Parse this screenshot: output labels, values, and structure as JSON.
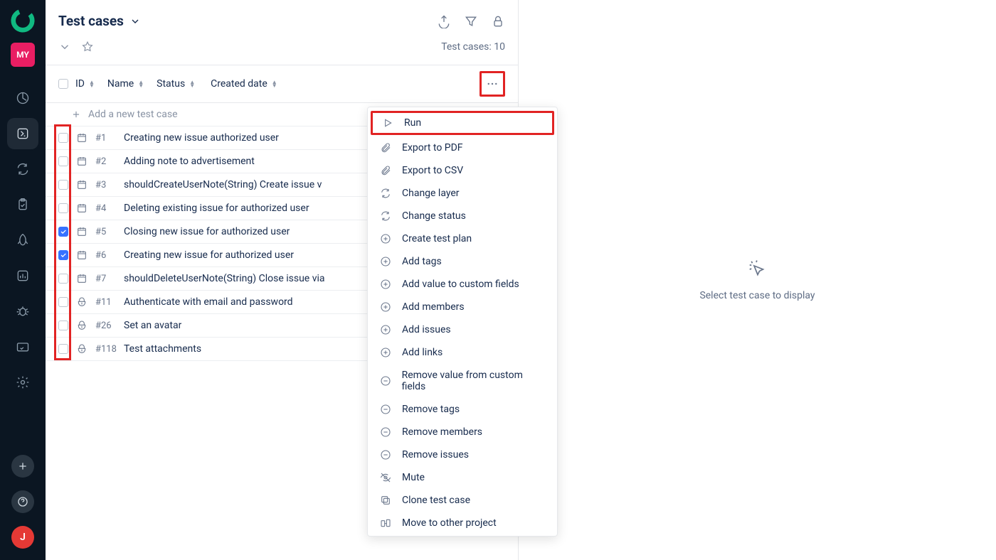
{
  "sidebar": {
    "project_badge": "MY",
    "avatar_letter": "J"
  },
  "header": {
    "title": "Test cases"
  },
  "subheader": {
    "count_label": "Test cases: 10"
  },
  "columns": {
    "id": "ID",
    "name": "Name",
    "status": "Status",
    "created": "Created date"
  },
  "add_row": {
    "label": "Add a new test case"
  },
  "rows": [
    {
      "id": "#1",
      "name": "Creating new issue authorized user",
      "checked": false,
      "type": "calendar"
    },
    {
      "id": "#2",
      "name": "Adding note to advertisement",
      "checked": false,
      "type": "calendar"
    },
    {
      "id": "#3",
      "name": "shouldCreateUserNote(String) Create issue v",
      "checked": false,
      "type": "calendar"
    },
    {
      "id": "#4",
      "name": "Deleting existing issue for authorized user",
      "checked": false,
      "type": "calendar"
    },
    {
      "id": "#5",
      "name": "Closing new issue for authorized user",
      "checked": true,
      "type": "calendar"
    },
    {
      "id": "#6",
      "name": "Creating new issue for authorized user",
      "checked": true,
      "type": "calendar"
    },
    {
      "id": "#7",
      "name": "shouldDeleteUserNote(String) Close issue via",
      "checked": false,
      "type": "calendar"
    },
    {
      "id": "#11",
      "name": "Authenticate with email and password",
      "checked": false,
      "type": "manual"
    },
    {
      "id": "#26",
      "name": "Set an avatar",
      "checked": false,
      "type": "manual"
    },
    {
      "id": "#118",
      "name": "Test attachments",
      "checked": false,
      "type": "manual"
    }
  ],
  "dropdown": {
    "items": [
      {
        "label": "Run",
        "icon": "play"
      },
      {
        "label": "Export to PDF",
        "icon": "attach"
      },
      {
        "label": "Export to CSV",
        "icon": "attach"
      },
      {
        "label": "Change layer",
        "icon": "refresh"
      },
      {
        "label": "Change status",
        "icon": "refresh"
      },
      {
        "label": "Create test plan",
        "icon": "plusc"
      },
      {
        "label": "Add tags",
        "icon": "plusc"
      },
      {
        "label": "Add value to custom fields",
        "icon": "plusc"
      },
      {
        "label": "Add members",
        "icon": "plusc"
      },
      {
        "label": "Add issues",
        "icon": "plusc"
      },
      {
        "label": "Add links",
        "icon": "plusc"
      },
      {
        "label": "Remove value from custom fields",
        "icon": "minusc"
      },
      {
        "label": "Remove tags",
        "icon": "minusc"
      },
      {
        "label": "Remove members",
        "icon": "minusc"
      },
      {
        "label": "Remove issues",
        "icon": "minusc"
      },
      {
        "label": "Mute",
        "icon": "mute"
      },
      {
        "label": "Clone test case",
        "icon": "clone"
      },
      {
        "label": "Move to other project",
        "icon": "move"
      }
    ]
  },
  "right_pane": {
    "empty_text": "Select test case to display"
  }
}
